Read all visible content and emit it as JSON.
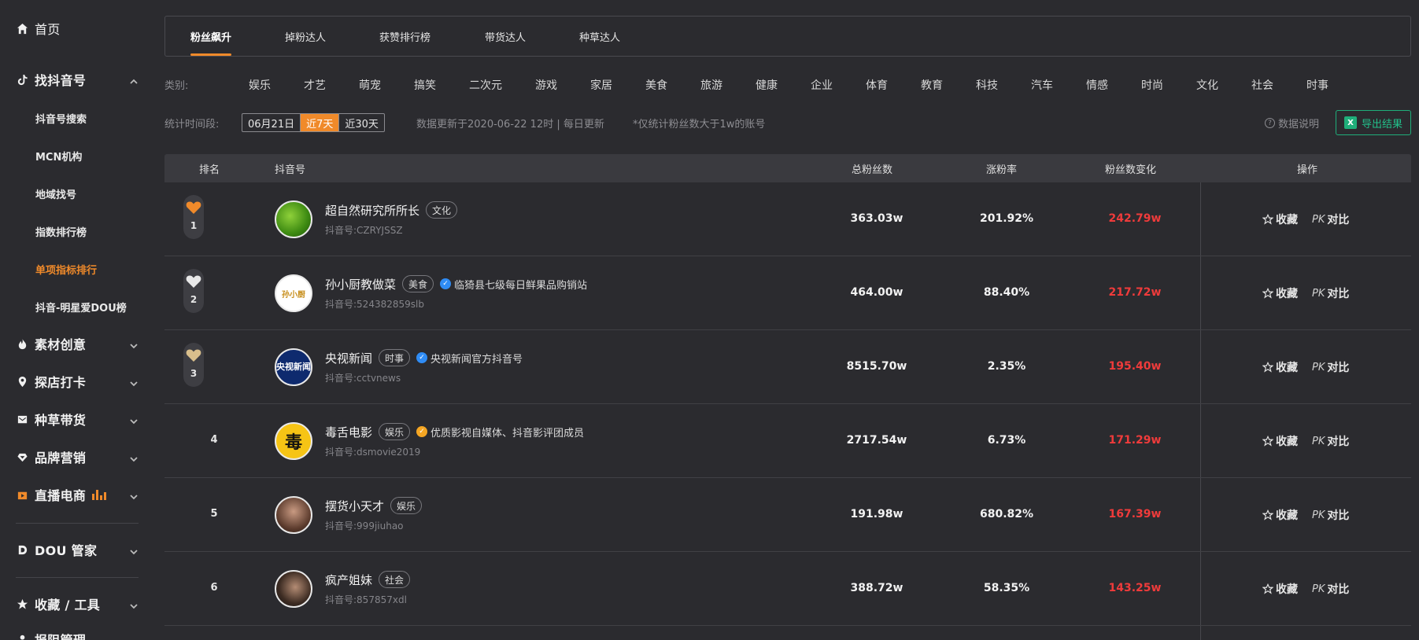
{
  "sidebar": {
    "home": "首页",
    "find_account": "找抖音号",
    "sub_items": [
      "抖音号搜索",
      "MCN机构",
      "地域找号",
      "指数排行榜",
      "单项指标排行",
      "抖音-明星爱DOU榜"
    ],
    "material": "素材创意",
    "store": "探店打卡",
    "grass": "种草带货",
    "brand": "品牌营销",
    "live": "直播电商",
    "dou_manager": "DOU 管家",
    "favorites_tools": "收藏 / 工具",
    "report": "报阻管理"
  },
  "tabs": [
    "粉丝飙升",
    "掉粉达人",
    "获赞排行榜",
    "带货达人",
    "种草达人"
  ],
  "filters": {
    "category_label": "类别:",
    "categories": [
      "娱乐",
      "才艺",
      "萌宠",
      "搞笑",
      "二次元",
      "游戏",
      "家居",
      "美食",
      "旅游",
      "健康",
      "企业",
      "体育",
      "教育",
      "科技",
      "汽车",
      "情感",
      "时尚",
      "文化",
      "社会",
      "时事"
    ],
    "period_label": "统计时间段:",
    "periods": [
      "06月21日",
      "近7天",
      "近30天"
    ],
    "update_note": "数据更新于2020-06-22 12时 | 每日更新",
    "fans_note": "*仅统计粉丝数大于1w的账号",
    "data_help": "数据说明",
    "export": "导出结果",
    "export_icon": "X"
  },
  "table": {
    "headers": [
      "排名",
      "抖音号",
      "总粉丝数",
      "涨粉率",
      "粉丝数变化",
      "操作"
    ],
    "fav_label": "收藏",
    "pk_label": "PK",
    "compare_label": "对比",
    "rows": [
      {
        "rank": "1",
        "name": "超自然研究所所长",
        "tag": "文化",
        "verify": "",
        "id": "抖音号:CZRYJSSZ",
        "total": "363.03w",
        "rate": "201.92%",
        "change": "242.79w",
        "medal": "#f08a2a"
      },
      {
        "rank": "2",
        "name": "孙小厨教做菜",
        "tag": "美食",
        "verify": "临猗县七级每日鲜果品购销站",
        "id": "抖音号:524382859slb",
        "total": "464.00w",
        "rate": "88.40%",
        "change": "217.72w",
        "medal": "#e8e8e8",
        "avatar_text": "孙小厨"
      },
      {
        "rank": "3",
        "name": "央视新闻",
        "tag": "时事",
        "verify": "央视新闻官方抖音号",
        "id": "抖音号:cctvnews",
        "total": "8515.70w",
        "rate": "2.35%",
        "change": "195.40w",
        "medal": "#d9bf8c",
        "avatar_text": "央视新闻"
      },
      {
        "rank": "4",
        "name": "毒舌电影",
        "tag": "娱乐",
        "verify": "优质影视自媒体、抖音影评团成员",
        "id": "抖音号:dsmovie2019",
        "total": "2717.54w",
        "rate": "6.73%",
        "change": "171.29w",
        "avatar_text": "毒"
      },
      {
        "rank": "5",
        "name": "摆货小天才",
        "tag": "娱乐",
        "verify": "",
        "id": "抖音号:999jiuhao",
        "total": "191.98w",
        "rate": "680.82%",
        "change": "167.39w"
      },
      {
        "rank": "6",
        "name": "疯产姐妹",
        "tag": "社会",
        "verify": "",
        "id": "抖音号:857857xdl",
        "total": "388.72w",
        "rate": "58.35%",
        "change": "143.25w"
      }
    ]
  },
  "colors": {
    "accent": "#f08a2a",
    "red": "#ef3b3b",
    "green": "#1fae7a",
    "bg": "#2b2b2f"
  }
}
